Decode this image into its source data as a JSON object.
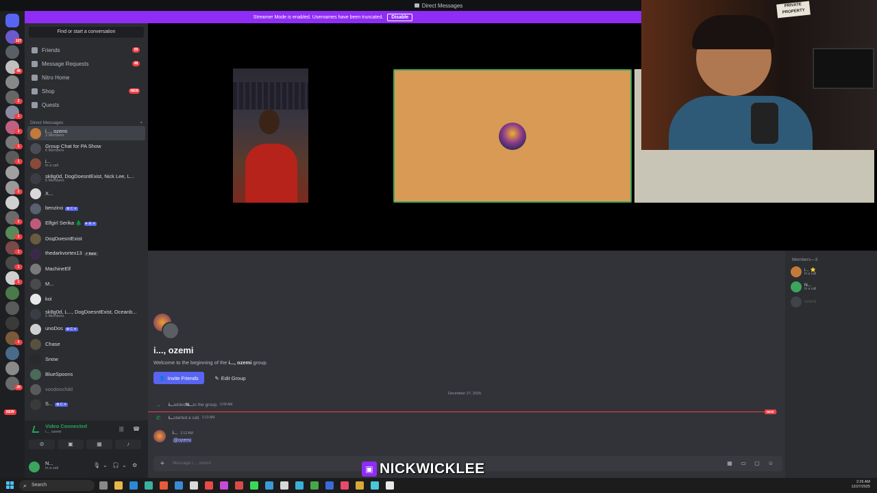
{
  "titlebar": {
    "title": "Direct Messages"
  },
  "banner": {
    "text": "Streamer Mode is enabled. Usernames have been truncated.",
    "disable_label": "Disable"
  },
  "rail": {
    "badges": [
      "107",
      "48",
      "2",
      "1",
      "1",
      "1",
      "1",
      "1",
      "1",
      "1",
      "1",
      "1",
      "1",
      "3",
      "20"
    ],
    "new_label": "NEW"
  },
  "sidebar": {
    "find_label": "Find or start a conversation",
    "nav": [
      {
        "label": "Friends",
        "count": "59"
      },
      {
        "label": "Message Requests",
        "count": "48"
      },
      {
        "label": "Nitro Home",
        "count": ""
      },
      {
        "label": "Shop",
        "count": "NEW"
      },
      {
        "label": "Quests",
        "count": ""
      }
    ],
    "dm_header": "Direct Messages",
    "dm_add": "+",
    "dms": [
      {
        "name": "i..., ozemi",
        "sub": "3 Members",
        "tag": "",
        "color": "#c27a3a"
      },
      {
        "name": "Group Chat for PA Show",
        "sub": "6 Members",
        "tag": "",
        "color": "#4a4d55"
      },
      {
        "name": "i...",
        "sub": "In a call",
        "tag": "",
        "color": "#8a4a3a"
      },
      {
        "name": "sk8g0d, DogDoesntExist, Nick Lee, L...",
        "sub": "5 Members",
        "tag": "",
        "color": "#3a3d45"
      },
      {
        "name": "X...",
        "sub": "",
        "tag": "",
        "color": "#d8d8d8"
      },
      {
        "name": "benzino",
        "sub": "",
        "tag": "✿ C ✕",
        "color": "#5a6070"
      },
      {
        "name": "Elfgirl Serika 🌲",
        "sub": "",
        "tag": "♥ ⁂ ✕",
        "color": "#c05a7a"
      },
      {
        "name": "DogDoesntExist",
        "sub": "",
        "tag": "",
        "color": "#6a5a40"
      },
      {
        "name": "thedarkvortex13",
        "sub": "",
        "tag": "⚡ bunz",
        "color": "#3a2a4a"
      },
      {
        "name": "MachineElf",
        "sub": "",
        "tag": "",
        "color": "#7a7a7a"
      },
      {
        "name": "M...",
        "sub": "",
        "tag": "",
        "color": "#4a4a4a"
      },
      {
        "name": "koi",
        "sub": "",
        "tag": "",
        "color": "#e8e8e8"
      },
      {
        "name": "sk8g0d, L..., DogDoesntExist, Oceanb...",
        "sub": "5 Members",
        "tag": "",
        "color": "#3a3d45"
      },
      {
        "name": "unoDos",
        "sub": "",
        "tag": "✿ C ✕",
        "color": "#d0d0d0"
      },
      {
        "name": "Chase",
        "sub": "",
        "tag": "",
        "color": "#5a5040"
      },
      {
        "name": "Snow",
        "sub": "",
        "tag": "",
        "color": "#2a2a2a"
      },
      {
        "name": "BlueSpoons",
        "sub": "",
        "tag": "",
        "color": "#4a6a5a"
      },
      {
        "name": "voodoochild",
        "sub": "",
        "tag": "",
        "color": "#5a5a5a"
      },
      {
        "name": "S...",
        "sub": "",
        "tag": "✿ C ✕",
        "color": "#3a3a3a"
      }
    ]
  },
  "voice": {
    "status": "Video Connected",
    "channel": "i..., ozemi"
  },
  "user": {
    "name": "N...",
    "status": "In a call"
  },
  "webcam": {
    "sign": "PRIVATE PROPERTY"
  },
  "members": {
    "header": "Members—3",
    "list": [
      {
        "name": "i... ⭐",
        "sub": "In a call",
        "color": "#c27a3a"
      },
      {
        "name": "N...",
        "sub": "In a call",
        "color": "#3ba55c"
      },
      {
        "name": "ozemi",
        "sub": "",
        "color": "#80848e"
      }
    ]
  },
  "chat": {
    "group_title": "i..., ozemi",
    "welcome_prefix": "Welcome to the beginning of the ",
    "welcome_name": "i..., ozemi",
    "welcome_suffix": " group.",
    "invite_label": "Invite Friends",
    "edit_label": "Edit Group",
    "date": "December 27, 2025",
    "events": [
      {
        "actor": "i...",
        "text1": " added ",
        "target": "N...",
        "text2": " to the group.",
        "time": "2:09 AM",
        "icon": "→"
      },
      {
        "actor": "i...",
        "text1": " started a call.",
        "target": "",
        "text2": "",
        "time": "2:10 AM",
        "icon": "✆"
      }
    ],
    "new_label": "NEW",
    "message": {
      "author": "i...",
      "time": "2:12 AM",
      "mention": "@ozemi"
    },
    "input_placeholder": "Message i..., ozemi"
  },
  "watermark": {
    "text": "NICKWICKLEE"
  },
  "taskbar": {
    "search_label": "Search",
    "time": "2:26 AM",
    "date": "12/27/2025"
  }
}
